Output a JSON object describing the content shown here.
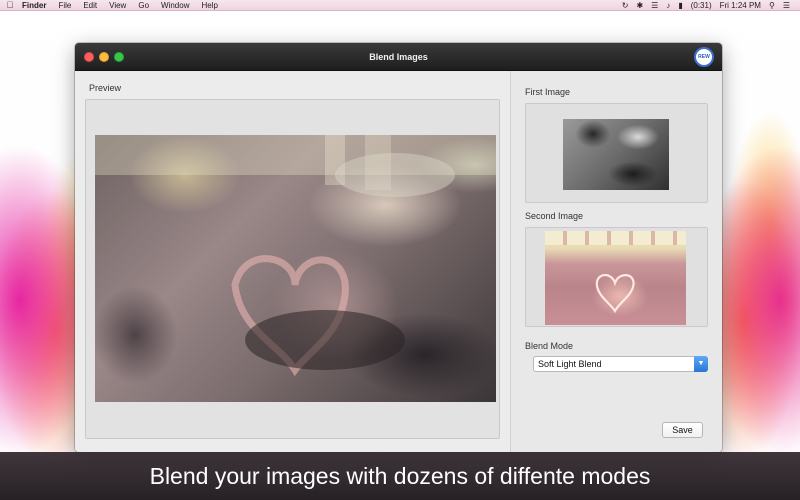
{
  "menubar": {
    "apple_icon": "apple-icon",
    "app_name": "Finder",
    "items": [
      "File",
      "Edit",
      "View",
      "Go",
      "Window",
      "Help"
    ],
    "status": {
      "battery": "(0:31)",
      "clock": "Fri 1:24 PM"
    }
  },
  "window": {
    "title": "Blend Images",
    "logo_text": "REW",
    "preview_label": "Preview",
    "first_image_label": "First Image",
    "second_image_label": "Second Image",
    "blend_mode_label": "Blend Mode",
    "blend_mode_value": "Soft Light Blend",
    "save_label": "Save"
  },
  "caption": "Blend your images with dozens of diffente modes",
  "colors": {
    "titlebar": "#2b2b2b",
    "close": "#fc605c",
    "minimize": "#fdbc40",
    "maximize": "#34c84a",
    "select_accent": "#2876d6",
    "caption_band": "#2a2226"
  }
}
